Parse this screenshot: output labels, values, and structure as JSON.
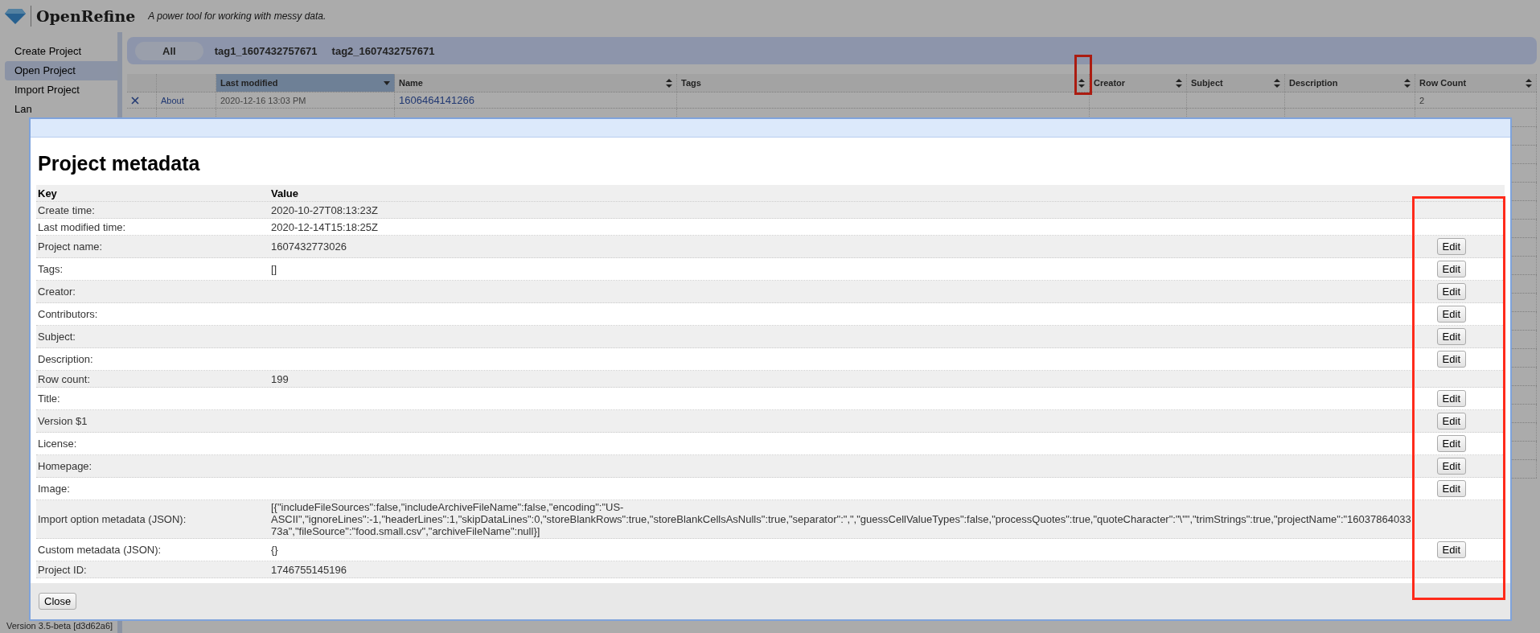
{
  "header": {
    "app_name": "OpenRefine",
    "tagline": "A power tool for working with messy data."
  },
  "sidebar": {
    "items": [
      {
        "label": "Create Project",
        "selected": false
      },
      {
        "label": "Open Project",
        "selected": true
      },
      {
        "label": "Import Project",
        "selected": false
      },
      {
        "label": "Lan",
        "selected": false
      }
    ]
  },
  "version": "Version 3.5-beta [d3d62a6]",
  "tag_filter": {
    "items": [
      {
        "label": "All",
        "selected": true
      },
      {
        "label": "tag1_1607432757671",
        "selected": false
      },
      {
        "label": "tag2_1607432757671",
        "selected": false
      }
    ]
  },
  "projects_table": {
    "columns": [
      {
        "label": "Last modified",
        "sorted": true
      },
      {
        "label": "Name",
        "sorted": false
      },
      {
        "label": "Tags",
        "sorted": false
      },
      {
        "label": "Creator",
        "sorted": false
      },
      {
        "label": "Subject",
        "sorted": false
      },
      {
        "label": "Description",
        "sorted": false
      },
      {
        "label": "Row Count",
        "sorted": false
      }
    ],
    "rows": [
      {
        "action": "About",
        "last_modified": "2020-12-16 13:03 PM",
        "name": "1606464141266",
        "tags": "",
        "creator": "",
        "subject": "",
        "description": "",
        "row_count": "2"
      }
    ]
  },
  "metadata_dialog": {
    "title": "Project metadata",
    "columns": [
      "Key",
      "Value"
    ],
    "rows": [
      {
        "key": "Create time:",
        "value": "2020-10-27T08:13:23Z"
      },
      {
        "key": "Last modified time:",
        "value": "2020-12-14T15:18:25Z"
      },
      {
        "key": "Project name:",
        "value": "1607432773026",
        "button": "Edit"
      },
      {
        "key": "Tags:",
        "value": "[]",
        "button": "Edit"
      },
      {
        "key": "Creator:",
        "value": "",
        "button": "Edit"
      },
      {
        "key": "Contributors:",
        "value": "",
        "button": "Edit"
      },
      {
        "key": "Subject:",
        "value": "",
        "button": "Edit"
      },
      {
        "key": "Description:",
        "value": "",
        "button": "Edit"
      },
      {
        "key": "Row count:",
        "value": "199"
      },
      {
        "key": "Title:",
        "value": "",
        "button": "Edit"
      },
      {
        "key": "Version $1",
        "value": "",
        "button": "Edit"
      },
      {
        "key": "License:",
        "value": "",
        "button": "Edit"
      },
      {
        "key": "Homepage:",
        "value": "",
        "button": "Edit"
      },
      {
        "key": "Image:",
        "value": "",
        "button": "Edit"
      },
      {
        "key": "Import option metadata (JSON):",
        "value": "[{\"includeFileSources\":false,\"includeArchiveFileName\":false,\"encoding\":\"US-ASCII\",\"ignoreLines\":-1,\"headerLines\":1,\"skipDataLines\":0,\"storeBlankRows\":true,\"storeBlankCellsAsNulls\":true,\"separator\":\",\",\"guessCellValueTypes\":false,\"processQuotes\":true,\"quoteCharacter\":\"\\\"\",\"trimStrings\":true,\"projectName\":\"1603786403373a\",\"fileSource\":\"food.small.csv\",\"archiveFileName\":null}]"
      },
      {
        "key": "Custom metadata (JSON):",
        "value": "{}",
        "button": "Edit"
      },
      {
        "key": "Project ID:",
        "value": "1746755145196"
      }
    ],
    "close_button": "Close"
  }
}
